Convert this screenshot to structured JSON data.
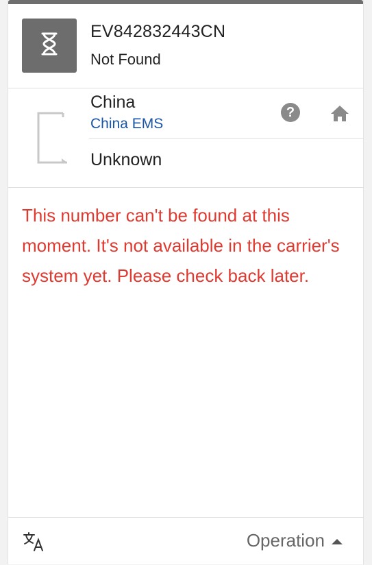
{
  "shipment": {
    "tracking_number": "EV842832443CN",
    "status": "Not Found",
    "status_icon": "hourglass-icon"
  },
  "carrier": {
    "country": "China",
    "name": "China EMS",
    "sub_status": "Unknown",
    "logo_icon": "carrier-logo-placeholder",
    "help_icon": "question-icon",
    "home_icon": "home-icon",
    "help_glyph": "?"
  },
  "message": {
    "text": "This number can't be found at this moment. It's not available in the carrier's system yet. Please check back later."
  },
  "footer": {
    "translate_icon": "translate-icon",
    "operation_label": "Operation",
    "operation_icon": "caret-up-icon"
  },
  "colors": {
    "error_text": "#e03a30",
    "link": "#1a56a6",
    "status_tile": "#6d6d6d"
  }
}
